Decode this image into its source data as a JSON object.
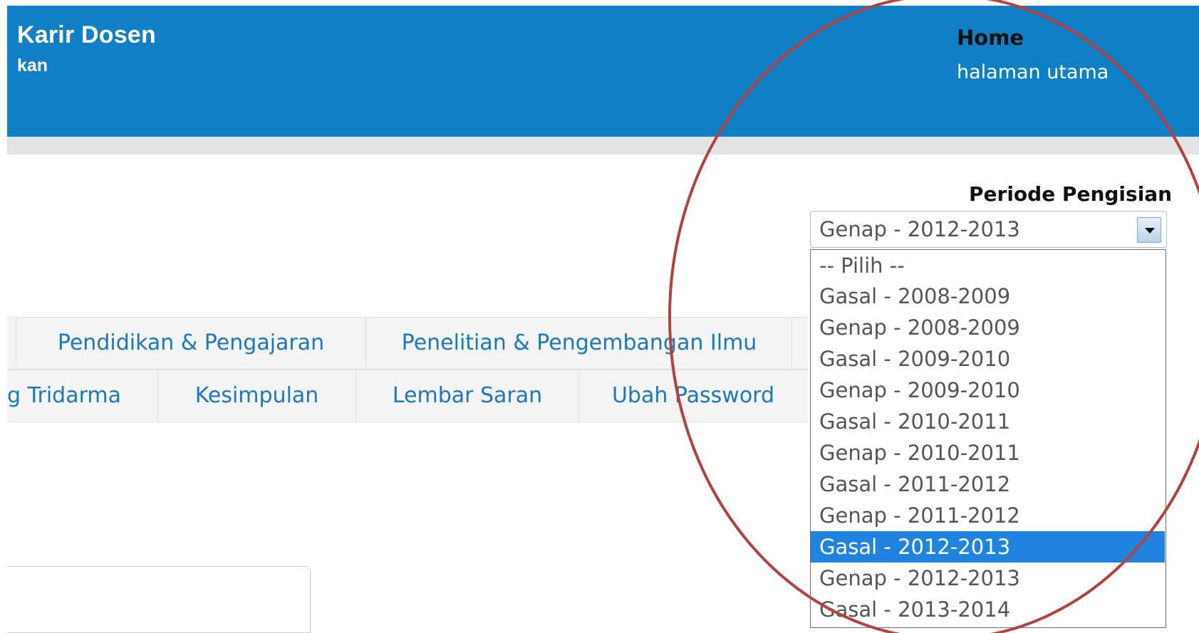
{
  "header": {
    "brand_title": "Karir Dosen",
    "brand_sub": "kan",
    "page_title": "Home",
    "page_subtitle": "halaman utama",
    "bg_color": "#0f7fc6"
  },
  "periode": {
    "label": "Periode Pengisian",
    "selected": "Genap - 2012-2013",
    "options": [
      "-- Pilih --",
      "Gasal - 2008-2009",
      "Genap - 2008-2009",
      "Gasal - 2009-2010",
      "Genap - 2009-2010",
      "Gasal - 2010-2011",
      "Genap - 2010-2011",
      "Gasal - 2011-2012",
      "Genap - 2011-2012",
      "Gasal - 2012-2013",
      "Genap - 2012-2013",
      "Gasal - 2013-2014"
    ],
    "highlighted": "Gasal - 2012-2013",
    "highlight_color": "#1e84df"
  },
  "nav": {
    "row1": [
      "Pendidikan & Pengajaran",
      "Penelitian & Pengembangan Ilmu"
    ],
    "row2": [
      "g Tridarma",
      "Kesimpulan",
      "Lembar Saran",
      "Ubah Password"
    ],
    "link_color": "#1a78c2"
  },
  "annotation": {
    "ellipse_color": "#b5413f"
  }
}
